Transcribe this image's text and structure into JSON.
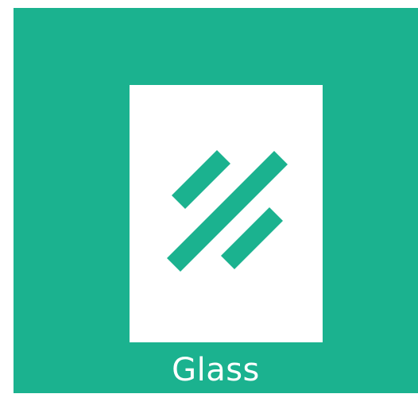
{
  "tile": {
    "label": "Glass",
    "icon": "glass-pane-icon",
    "colors": {
      "background": "#1bb28f",
      "pane": "#ffffff",
      "label": "#ffffff"
    }
  }
}
